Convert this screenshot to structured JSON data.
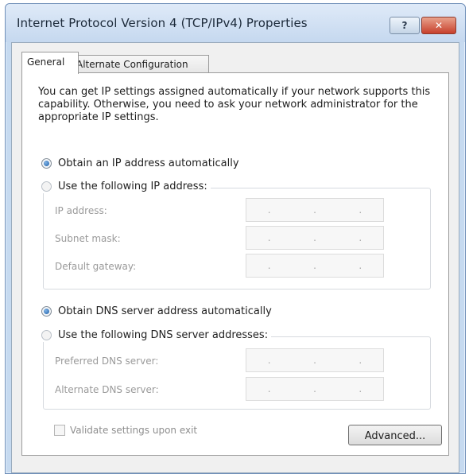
{
  "window": {
    "title": "Internet Protocol Version 4 (TCP/IPv4) Properties",
    "help_label": "?",
    "close_label": "✕"
  },
  "tabs": [
    {
      "label": "General",
      "active": true
    },
    {
      "label": "Alternate Configuration",
      "active": false
    }
  ],
  "intro_text": "You can get IP settings assigned automatically if your network supports this capability. Otherwise, you need to ask your network administrator for the appropriate IP settings.",
  "ip_section": {
    "auto_label": "Obtain an IP address automatically",
    "auto_checked": true,
    "manual_label": "Use the following IP address:",
    "manual_checked": false,
    "fields": [
      {
        "label": "IP address:",
        "value": ". . ."
      },
      {
        "label": "Subnet mask:",
        "value": ". . ."
      },
      {
        "label": "Default gateway:",
        "value": ". . ."
      }
    ]
  },
  "dns_section": {
    "auto_label": "Obtain DNS server address automatically",
    "auto_checked": true,
    "manual_label": "Use the following DNS server addresses:",
    "manual_checked": false,
    "fields": [
      {
        "label": "Preferred DNS server:",
        "value": ". . ."
      },
      {
        "label": "Alternate DNS server:",
        "value": ". . ."
      }
    ]
  },
  "validate_label": "Validate settings upon exit",
  "validate_checked": false,
  "advanced_label": "Advanced..."
}
